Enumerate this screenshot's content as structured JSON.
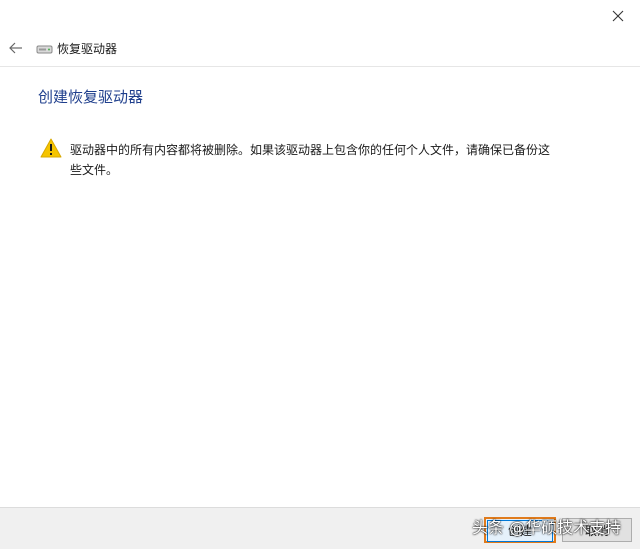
{
  "window": {
    "close_icon": "close-icon"
  },
  "nav": {
    "back_icon": "back-arrow-icon",
    "drive_icon": "drive-icon",
    "title": "恢复驱动器"
  },
  "content": {
    "heading": "创建恢复驱动器",
    "warning_icon": "warning-icon",
    "warning_text": "驱动器中的所有内容都将被删除。如果该驱动器上包含你的任何个人文件，请确保已备份这些文件。"
  },
  "footer": {
    "next_label": "创建",
    "cancel_label": "取消",
    "watermark": "头条 @华硕技术支持"
  },
  "colors": {
    "heading": "#1e3e8c",
    "highlight": "#e07b1c",
    "warning": "#f5c400"
  }
}
